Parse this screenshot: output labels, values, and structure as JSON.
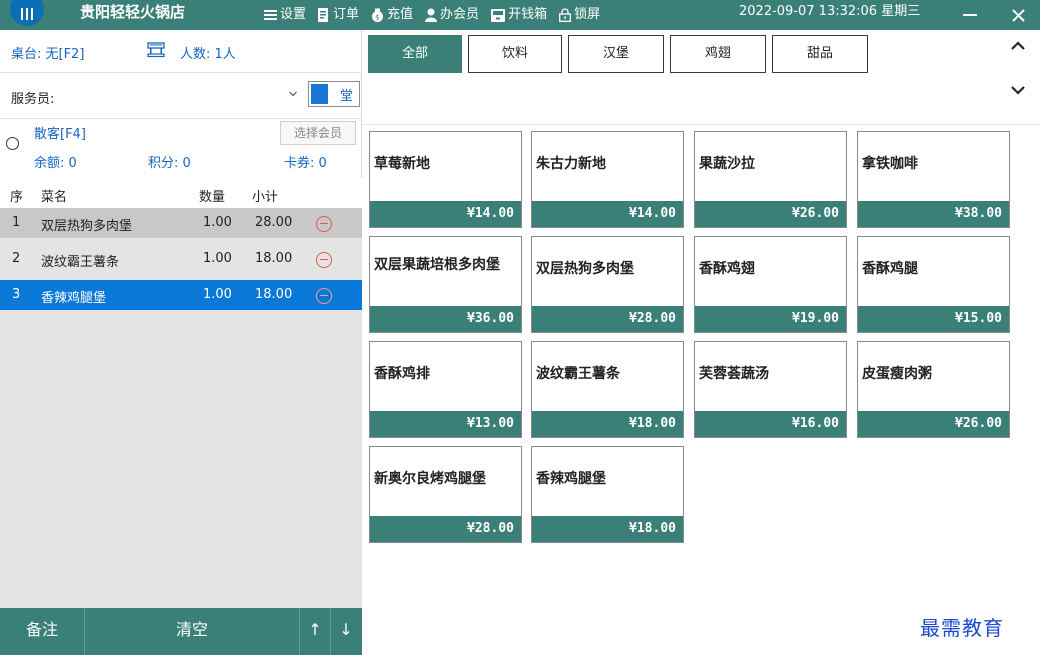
{
  "titlebar": {
    "app_name": "贵阳轻轻火锅店",
    "items": [
      {
        "label": "设置",
        "icon": "menu-icon"
      },
      {
        "label": "订单",
        "icon": "order-icon"
      },
      {
        "label": "充值",
        "icon": "money-bag-icon"
      },
      {
        "label": "办会员",
        "icon": "user-icon"
      },
      {
        "label": "开钱箱",
        "icon": "cashbox-icon"
      },
      {
        "label": "锁屏",
        "icon": "lock-icon"
      }
    ],
    "datetime": "2022-09-07 13:32:06  星期三",
    "minimize": "—",
    "close": "✕"
  },
  "left": {
    "table_label": "桌台: 无[F2]",
    "people_label": "人数: 1人",
    "waiter_label": "服务员:",
    "dine_mode": "堂",
    "member_name": "散客[F4]",
    "choose_member": "选择会员",
    "balance_label": "余额: 0",
    "points_label": "积分: 0",
    "coupon_label": "卡券: 0",
    "columns": {
      "no": "序",
      "name": "菜名",
      "qty": "数量",
      "subtotal": "小计"
    },
    "orders": [
      {
        "no": "1",
        "name": "双层热狗多肉堡",
        "qty": "1.00",
        "subtotal": "28.00"
      },
      {
        "no": "2",
        "name": "波纹霸王薯条",
        "qty": "1.00",
        "subtotal": "18.00"
      },
      {
        "no": "3",
        "name": "香辣鸡腿堡",
        "qty": "1.00",
        "subtotal": "18.00"
      }
    ],
    "buttons": {
      "note": "备注",
      "clear": "清空",
      "up": "↑",
      "down": "↓"
    }
  },
  "categories": [
    {
      "label": "全部",
      "active": true
    },
    {
      "label": "饮料"
    },
    {
      "label": "汉堡"
    },
    {
      "label": "鸡翅"
    },
    {
      "label": "甜品"
    }
  ],
  "products": [
    {
      "name": "草莓新地",
      "price": "¥14.00"
    },
    {
      "name": "朱古力新地",
      "price": "¥14.00"
    },
    {
      "name": "果蔬沙拉",
      "price": "¥26.00"
    },
    {
      "name": "拿铁咖啡",
      "price": "¥38.00"
    },
    {
      "name": "双层果蔬培根多肉堡",
      "price": "¥36.00"
    },
    {
      "name": "双层热狗多肉堡",
      "price": "¥28.00"
    },
    {
      "name": "香酥鸡翅",
      "price": "¥19.00"
    },
    {
      "name": "香酥鸡腿",
      "price": "¥15.00"
    },
    {
      "name": "香酥鸡排",
      "price": "¥13.00"
    },
    {
      "name": "波纹霸王薯条",
      "price": "¥18.00"
    },
    {
      "name": "芙蓉荟蔬汤",
      "price": "¥16.00"
    },
    {
      "name": "皮蛋瘦肉粥",
      "price": "¥26.00"
    },
    {
      "name": "新奥尔良烤鸡腿堡",
      "price": "¥28.00"
    },
    {
      "name": "香辣鸡腿堡",
      "price": "¥18.00"
    }
  ],
  "watermark": "最需教育",
  "colors": {
    "primary": "#3a8078",
    "selected_row": "#0a78d7",
    "link_text": "#1565c0"
  }
}
